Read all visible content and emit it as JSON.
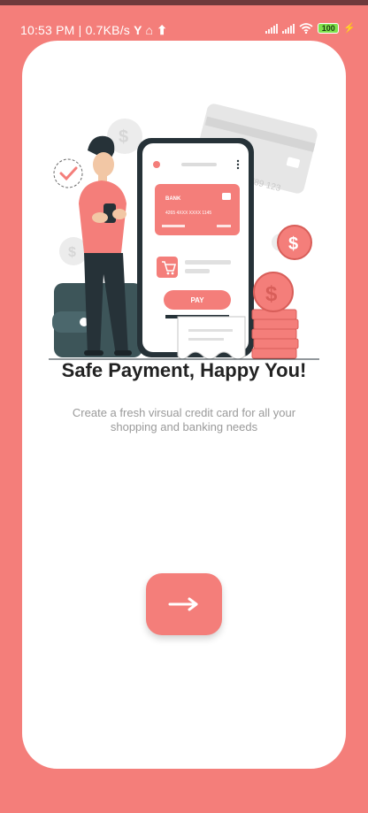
{
  "status_bar": {
    "time": "10:53 PM",
    "network_speed": "0.7KB/s",
    "battery_level": "100"
  },
  "onboarding": {
    "title": "Safe Payment, Happy You!",
    "subtitle": "Create a fresh virsual credit card for all your shopping and banking needs",
    "illustration": {
      "bank_label": "BANK",
      "card_number": "4265 4XXX XXXX 1145",
      "pay_label": "PAY",
      "bg_card_number": "789 123"
    },
    "next_icon": "arrow-right-icon"
  },
  "colors": {
    "accent": "#f47e7a",
    "background": "#f47e7a",
    "card": "#ffffff",
    "title": "#222222",
    "subtitle": "#9a9a9a"
  }
}
